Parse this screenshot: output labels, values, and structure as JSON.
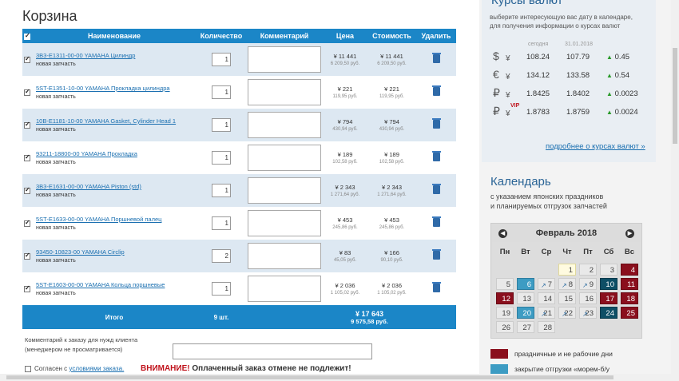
{
  "cart": {
    "title": "Корзина",
    "headers": {
      "name": "Наименование",
      "qty": "Количество",
      "comment": "Комментарий",
      "price": "Цена",
      "cost": "Стоимость",
      "delete": "Удалить"
    },
    "items": [
      {
        "link": "3B3-E1311-00-00 YAMAHA Цилиндр",
        "sub": "новая запчасть",
        "qty": "1",
        "price_yen": "¥ 11 441",
        "price_rub": "6 209,50 руб.",
        "cost_yen": "¥ 11 441",
        "cost_rub": "6 209,50 руб."
      },
      {
        "link": "5ST-E1351-10-00 YAMAHA Прокладка цилиндра",
        "sub": "новая запчасть",
        "qty": "1",
        "price_yen": "¥ 221",
        "price_rub": "119,95 руб.",
        "cost_yen": "¥ 221",
        "cost_rub": "119,95 руб."
      },
      {
        "link": "10B-E1181-10-00 YAMAHA Gasket, Cylinder Head 1",
        "sub": "новая запчасть",
        "qty": "1",
        "price_yen": "¥ 794",
        "price_rub": "430,94 руб.",
        "cost_yen": "¥ 794",
        "cost_rub": "430,94 руб."
      },
      {
        "link": "93211-18800-00 YAMAHA Прокладка",
        "sub": "новая запчасть",
        "qty": "1",
        "price_yen": "¥ 189",
        "price_rub": "102,58 руб.",
        "cost_yen": "¥ 189",
        "cost_rub": "102,58 руб."
      },
      {
        "link": "3B3-E1631-00-00 YAMAHA Piston (std)",
        "sub": "новая запчасть",
        "qty": "1",
        "price_yen": "¥ 2 343",
        "price_rub": "1 271,64 руб.",
        "cost_yen": "¥ 2 343",
        "cost_rub": "1 271,64 руб."
      },
      {
        "link": "5ST-E1633-00-00 YAMAHA Поршневой палец",
        "sub": "новая запчасть",
        "qty": "1",
        "price_yen": "¥ 453",
        "price_rub": "245,86 руб.",
        "cost_yen": "¥ 453",
        "cost_rub": "245,86 руб."
      },
      {
        "link": "93450-10823-00 YAMAHA Circlip",
        "sub": "новая запчасть",
        "qty": "2",
        "price_yen": "¥ 83",
        "price_rub": "45,05 руб.",
        "cost_yen": "¥ 166",
        "cost_rub": "90,10 руб."
      },
      {
        "link": "5ST-E1603-00-00 YAMAHA Кольца поршневые",
        "sub": "новая запчасть",
        "qty": "1",
        "price_yen": "¥ 2 036",
        "price_rub": "1 105,02 руб.",
        "cost_yen": "¥ 2 036",
        "cost_rub": "1 105,02 руб."
      }
    ],
    "total": {
      "label": "Итого",
      "qty": "9 шт.",
      "yen": "¥ 17 643",
      "rub": "9 575,58 руб."
    },
    "comment_label_1": "Комментарий к заказу для нужд клиента",
    "comment_label_2": "(менеджером не просматривается)",
    "agree_prefix": "Согласен с ",
    "agree_link": "условиями заказа.",
    "warning_red": "ВНИМАНИЕ!",
    "warning_text": " Оплаченный заказ отмене не подлежит!"
  },
  "rates": {
    "title": "Курсы валют",
    "desc_1": "выберите интересующую вас дату в календаре,",
    "desc_2": "для получения информации о курсах валют",
    "col_today": "сегодня",
    "col_date": "31.01.2018",
    "rows": [
      {
        "sym": "$",
        "sym2": "¥",
        "vip": "",
        "today": "108.24",
        "prev": "107.79",
        "change": "0.45"
      },
      {
        "sym": "€",
        "sym2": "¥",
        "vip": "",
        "today": "134.12",
        "prev": "133.58",
        "change": "0.54"
      },
      {
        "sym": "₽",
        "sym2": "¥",
        "vip": "",
        "today": "1.8425",
        "prev": "1.8402",
        "change": "0.0023"
      },
      {
        "sym": "₽",
        "sym2": "¥",
        "vip": "VIP",
        "today": "1.8783",
        "prev": "1.8759",
        "change": "0.0024"
      }
    ],
    "more_link": "подробнее о курсах валют »"
  },
  "calendar": {
    "title": "Календарь",
    "desc_1": "с указанием японских праздников",
    "desc_2": "и планируемых отгрузок запчастей",
    "month": "Февраль 2018",
    "weekdays": [
      "Пн",
      "Вт",
      "Ср",
      "Чт",
      "Пт",
      "Сб",
      "Вс"
    ],
    "days": [
      "1",
      "2",
      "3",
      "4",
      "5",
      "6",
      "7",
      "8",
      "9",
      "10",
      "11",
      "12",
      "13",
      "14",
      "15",
      "16",
      "17",
      "18",
      "19",
      "20",
      "21",
      "22",
      "23",
      "24",
      "25",
      "26",
      "27",
      "28"
    ],
    "legend": [
      {
        "label": "праздничные и не рабочие дни",
        "color": "#8a0f1d"
      },
      {
        "label": "закрытие отгрузки «морем-б/у",
        "color": "#3d9cc3"
      }
    ]
  },
  "colors": {
    "accent": "#1b86c7",
    "holiday": "#8a0f1d",
    "shipping": "#3d9cc3"
  }
}
